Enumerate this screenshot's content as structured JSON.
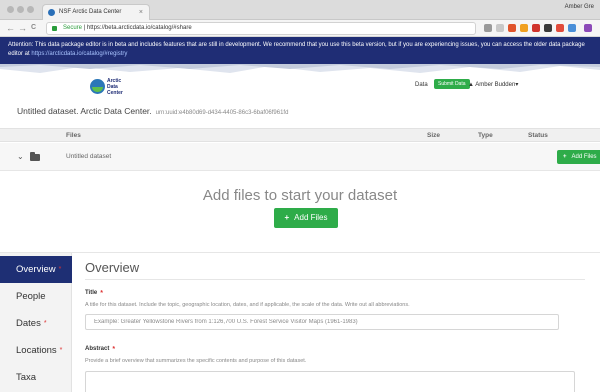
{
  "browser": {
    "tab_title": "NSF Arctic Data Center",
    "tab_close": "×",
    "profile_name": "Amber Gre",
    "url_secure_label": "Secure",
    "url": "https://beta.arcticdata.io/catalog/#share",
    "back_glyph": "←",
    "forward_glyph": "→",
    "reload_glyph": "C"
  },
  "banner": {
    "text": "Attention: This data package editor is in beta and includes features that are still in development. We recommend that you use this beta version, but if you are experiencing issues, you can access the older data package editor at ",
    "link_text": "https://arcticdata.io/catalog/#registry"
  },
  "header": {
    "logo_lines": [
      "Arctic",
      "Data",
      "Center"
    ],
    "data_link": "Data",
    "submit_label": "Submit Data",
    "user_name": "Amber Budden",
    "user_caret": "▾"
  },
  "dataset": {
    "title": "Untitled dataset. Arctic Data Center.",
    "identifier": "urn:uuid:e4b80d69-d434-4405-86c3-6baf06f961fd"
  },
  "files": {
    "headers": {
      "files": "Files",
      "size": "Size",
      "type": "Type",
      "status": "Status"
    },
    "row_chevron": "⌄",
    "row_name": "Untitled dataset",
    "add_small_label": "Add Files",
    "dropzone_text": "Add files to start your dataset",
    "add_big_label": "Add Files",
    "plus_glyph": "+"
  },
  "sidebar": {
    "items": [
      {
        "label": "Overview",
        "required": "*"
      },
      {
        "label": "People",
        "required": ""
      },
      {
        "label": "Dates",
        "required": "*"
      },
      {
        "label": "Locations",
        "required": "*"
      },
      {
        "label": "Taxa",
        "required": ""
      }
    ]
  },
  "overview": {
    "heading": "Overview",
    "title_label": "Title",
    "title_required": "*",
    "title_desc": "A title for this dataset. Include the topic, geographic location, dates, and if applicable, the scale of the data. Write out all abbreviations.",
    "title_placeholder": "Example: Greater Yellowstone Rivers from 1:126,700 U.S. Forest Service Visitor Maps (1961-1983)",
    "abstract_label": "Abstract",
    "abstract_required": "*",
    "abstract_desc": "Provide a brief overview that summarizes the specific contents and purpose of this dataset."
  },
  "colors": {
    "banner": "#1f2d75",
    "accent_green": "#2eac49",
    "sidebar_active": "#1e2f74",
    "required": "#d33333"
  },
  "icons": [
    "favicon-icon",
    "lock-icon",
    "folder-icon",
    "chevron-down-icon",
    "plus-icon",
    "logo-icon"
  ]
}
